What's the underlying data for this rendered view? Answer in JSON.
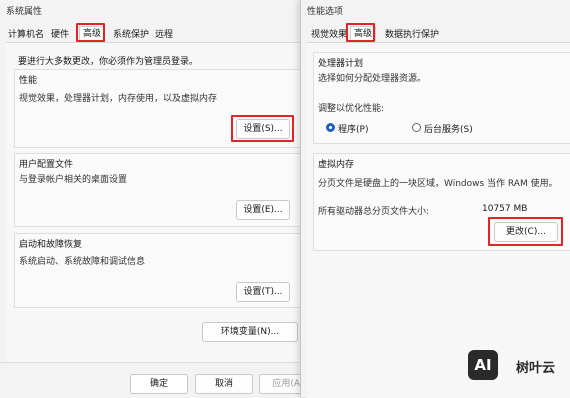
{
  "system_props": {
    "window_title": "系统属性",
    "tabs": [
      "计算机名",
      "硬件",
      "高级",
      "系统保护",
      "远程"
    ],
    "admin_note": "要进行大多数更改，你必须作为管理员登录。",
    "performance": {
      "title": "性能",
      "desc": "视觉效果，处理器计划，内存使用，以及虚拟内存",
      "button": "设置(S)..."
    },
    "user_profiles": {
      "title": "用户配置文件",
      "desc": "与登录帐户相关的桌面设置",
      "button": "设置(E)..."
    },
    "startup_recovery": {
      "title": "启动和故障恢复",
      "desc": "系统启动、系统故障和调试信息",
      "button": "设置(T)..."
    },
    "env_button": "环境变量(N)...",
    "ok": "确定",
    "cancel": "取消",
    "apply": "应用(A)"
  },
  "perf_options": {
    "window_title": "性能选项",
    "tabs": [
      "视觉效果",
      "高级",
      "数据执行保护"
    ],
    "processor": {
      "title": "处理器计划",
      "desc": "选择如何分配处理器资源。",
      "adjust_label": "调整以优化性能:",
      "opt_programs": "程序(P)",
      "opt_services": "后台服务(S)"
    },
    "virtual_memory": {
      "title": "虚拟内存",
      "desc": "分页文件是硬盘上的一块区域，Windows 当作 RAM 使用。",
      "total_label": "所有驱动器总分页文件大小:",
      "total_value": "10757 MB",
      "change_button": "更改(C)..."
    }
  },
  "watermark": {
    "logo": "AI",
    "text": "树叶云"
  }
}
